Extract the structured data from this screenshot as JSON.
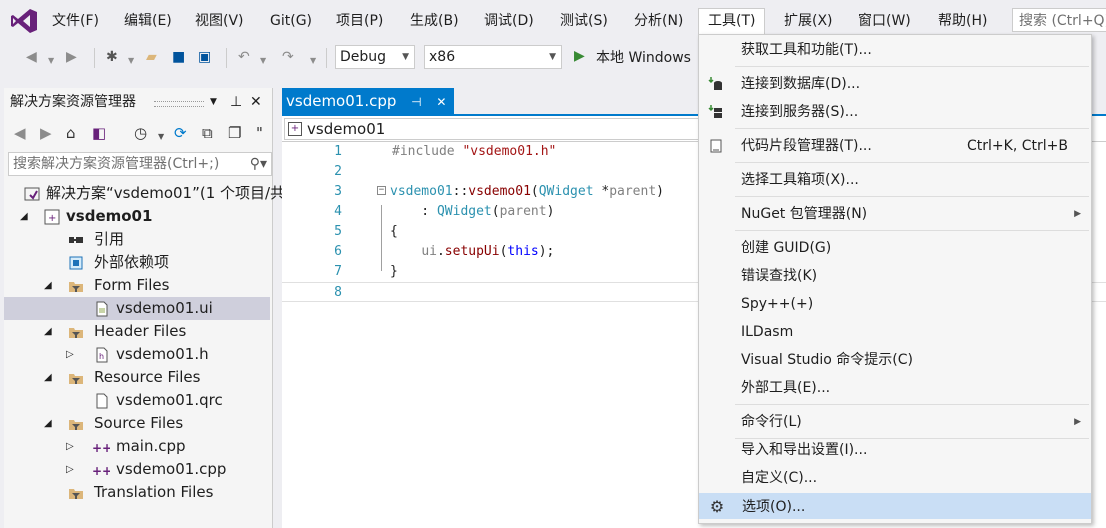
{
  "menubar": {
    "items": [
      "文件(F)",
      "编辑(E)",
      "视图(V)",
      "Git(G)",
      "项目(P)",
      "生成(B)",
      "调试(D)",
      "测试(S)",
      "分析(N)",
      "工具(T)",
      "扩展(X)",
      "窗口(W)",
      "帮助(H)"
    ],
    "search_placeholder": "搜索 (Ctrl+Q)"
  },
  "toolbar": {
    "config": "Debug",
    "platform": "x86",
    "run_label": "本地 Windows"
  },
  "solution_explorer": {
    "title": "解决方案资源管理器",
    "search_placeholder": "搜索解决方案资源管理器(Ctrl+;)",
    "tree": [
      {
        "label": "解决方案“vsdemo01”(1 个项目/共",
        "icon": "solution-icon"
      },
      {
        "label": "vsdemo01",
        "icon": "project-icon"
      },
      {
        "label": "引用",
        "icon": "references-icon"
      },
      {
        "label": "外部依赖项",
        "icon": "external-deps-icon"
      },
      {
        "label": "Form Files",
        "icon": "filter-icon"
      },
      {
        "label": "vsdemo01.ui",
        "icon": "ui-file-icon"
      },
      {
        "label": "Header Files",
        "icon": "filter-icon"
      },
      {
        "label": "vsdemo01.h",
        "icon": "header-file-icon"
      },
      {
        "label": "Resource Files",
        "icon": "filter-icon"
      },
      {
        "label": "vsdemo01.qrc",
        "icon": "file-icon"
      },
      {
        "label": "Source Files",
        "icon": "filter-icon"
      },
      {
        "label": "main.cpp",
        "icon": "cpp-file-icon"
      },
      {
        "label": "vsdemo01.cpp",
        "icon": "cpp-file-icon"
      },
      {
        "label": "Translation Files",
        "icon": "filter-icon"
      }
    ]
  },
  "editor": {
    "tab_label": "vsdemo01.cpp",
    "nav_scope": "vsdemo01",
    "lines": [
      {
        "n": "1",
        "text": "#include \"vsdemo01.h\""
      },
      {
        "n": "2",
        "text": ""
      },
      {
        "n": "3",
        "text": "vsdemo01::vsdemo01(QWidget *parent)"
      },
      {
        "n": "4",
        "text": "    : QWidget(parent)"
      },
      {
        "n": "5",
        "text": "{"
      },
      {
        "n": "6",
        "text": "    ui.setupUi(this);"
      },
      {
        "n": "7",
        "text": "}"
      },
      {
        "n": "8",
        "text": ""
      }
    ]
  },
  "tools_menu": {
    "items": [
      {
        "label": "获取工具和功能(T)...",
        "shortcut": "",
        "icon": ""
      },
      {
        "label": "连接到数据库(D)...",
        "shortcut": "",
        "icon": "database-connect-icon"
      },
      {
        "label": "连接到服务器(S)...",
        "shortcut": "",
        "icon": "server-connect-icon"
      },
      {
        "label": "代码片段管理器(T)...",
        "shortcut": "Ctrl+K, Ctrl+B",
        "icon": "snippet-icon"
      },
      {
        "label": "选择工具箱项(X)...",
        "shortcut": "",
        "icon": ""
      },
      {
        "label": "NuGet 包管理器(N)",
        "shortcut": "",
        "icon": ""
      },
      {
        "label": "创建 GUID(G)",
        "shortcut": "",
        "icon": ""
      },
      {
        "label": "错误查找(K)",
        "shortcut": "",
        "icon": ""
      },
      {
        "label": "Spy++(+)",
        "shortcut": "",
        "icon": ""
      },
      {
        "label": "ILDasm",
        "shortcut": "",
        "icon": ""
      },
      {
        "label": "Visual Studio 命令提示(C)",
        "shortcut": "",
        "icon": ""
      },
      {
        "label": "外部工具(E)...",
        "shortcut": "",
        "icon": ""
      },
      {
        "label": "命令行(L)",
        "shortcut": "",
        "icon": ""
      },
      {
        "label": "导入和导出设置(I)...",
        "shortcut": "",
        "icon": ""
      },
      {
        "label": "自定义(C)...",
        "shortcut": "",
        "icon": ""
      },
      {
        "label": "选项(O)...",
        "shortcut": "",
        "icon": "gear-icon"
      }
    ]
  },
  "colors": {
    "accent": "#007acc",
    "menu_highlight": "#c9def5",
    "tree_selected": "#cfcfdc",
    "vs_purple": "#68217a"
  }
}
